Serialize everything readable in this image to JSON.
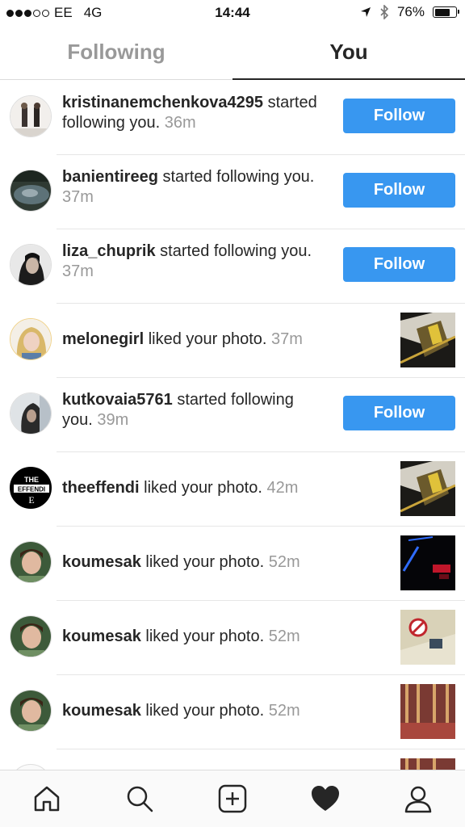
{
  "status_bar": {
    "carrier": "EE",
    "network": "4G",
    "time": "14:44",
    "battery": "76%",
    "battery_level": 0.76
  },
  "tabs": [
    {
      "label": "Following",
      "active": false
    },
    {
      "label": "You",
      "active": true
    }
  ],
  "activity": [
    {
      "username": "kristinanemchenkova4295",
      "action": "started following you.",
      "time": "36m",
      "button": "Follow"
    },
    {
      "username": "banientireeg",
      "action": "started following you.",
      "time": "37m",
      "button": "Follow"
    },
    {
      "username": "liza_chuprik",
      "action": "started following you.",
      "time": "37m",
      "button": "Follow"
    },
    {
      "username": "melonegirl",
      "action": "liked your photo.",
      "time": "37m"
    },
    {
      "username": "kutkovaia5761",
      "action": "started following you.",
      "time": "39m",
      "button": "Follow"
    },
    {
      "username": "theeffendi",
      "action": "liked your photo.",
      "time": "42m",
      "avatar_text": "THE EFFENDI"
    },
    {
      "username": "koumesak",
      "action": "liked your photo.",
      "time": "52m"
    },
    {
      "username": "koumesak",
      "action": "liked your photo.",
      "time": "52m"
    },
    {
      "username": "koumesak",
      "action": "liked your photo.",
      "time": "52m"
    }
  ],
  "bottom_nav": [
    "home-icon",
    "search-icon",
    "add-icon",
    "heart-icon",
    "profile-icon"
  ],
  "colors": {
    "follow_button": "#3897f0",
    "muted": "#999999",
    "text": "#262626"
  }
}
